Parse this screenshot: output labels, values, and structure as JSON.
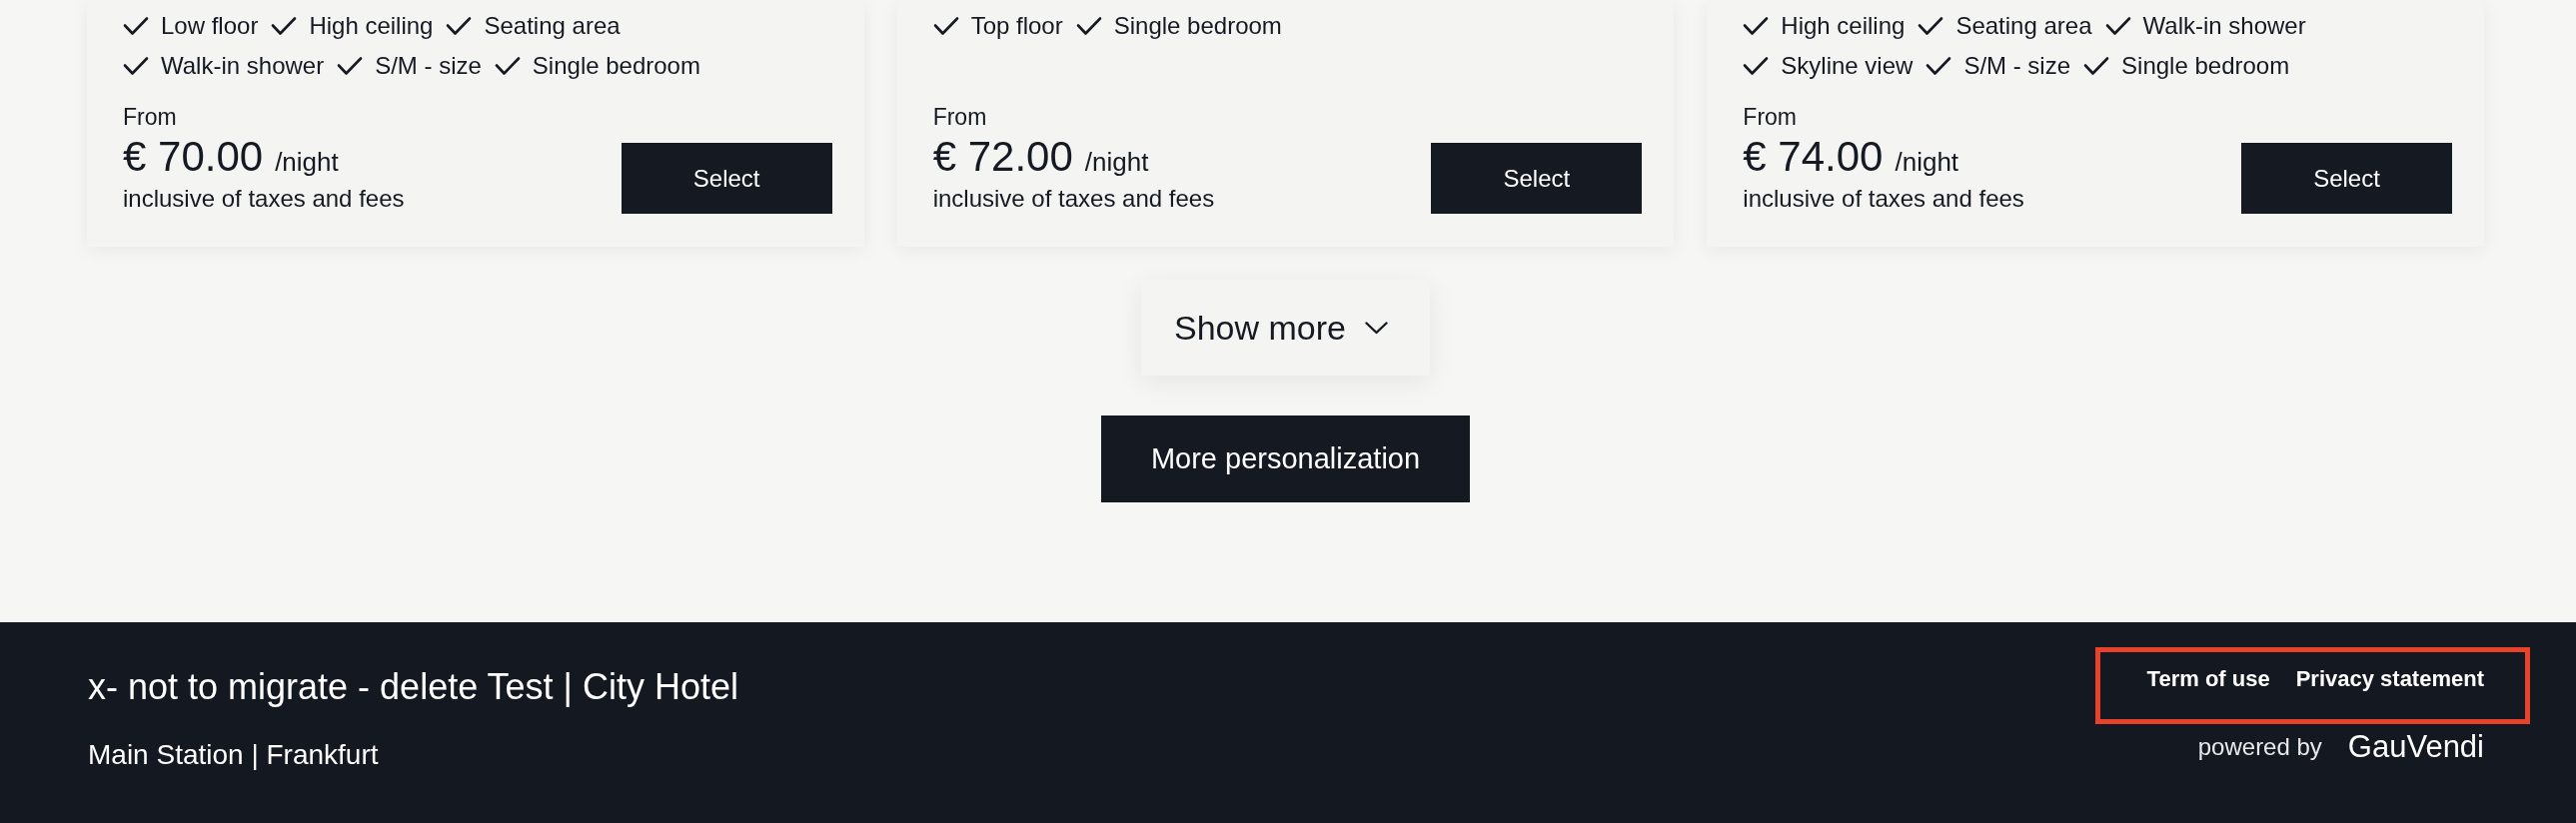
{
  "rooms": [
    {
      "features": [
        "Low floor",
        "High ceiling",
        "Seating area",
        "Walk-in shower",
        "S/M - size",
        "Single bedroom"
      ],
      "from_label": "From",
      "price": "€ 70.00",
      "unit": "/night",
      "note": "inclusive of taxes and fees",
      "button": "Select"
    },
    {
      "features": [
        "Top floor",
        "Single bedroom"
      ],
      "from_label": "From",
      "price": "€ 72.00",
      "unit": "/night",
      "note": "inclusive of taxes and fees",
      "button": "Select"
    },
    {
      "features": [
        "High ceiling",
        "Seating area",
        "Walk-in shower",
        "Skyline view",
        "S/M - size",
        "Single bedroom"
      ],
      "from_label": "From",
      "price": "€ 74.00",
      "unit": "/night",
      "note": "inclusive of taxes and fees",
      "button": "Select"
    }
  ],
  "show_more": {
    "label": "Show more"
  },
  "personalize_button": {
    "label": "More personalization"
  },
  "footer": {
    "hotel_name": "x- not to migrate - delete Test | City Hotel",
    "location": "Main Station | Frankfurt",
    "links": [
      "Term of use",
      "Privacy statement"
    ],
    "links_highlighted": true,
    "powered_by": "powered by",
    "brand": "GauVendi"
  }
}
